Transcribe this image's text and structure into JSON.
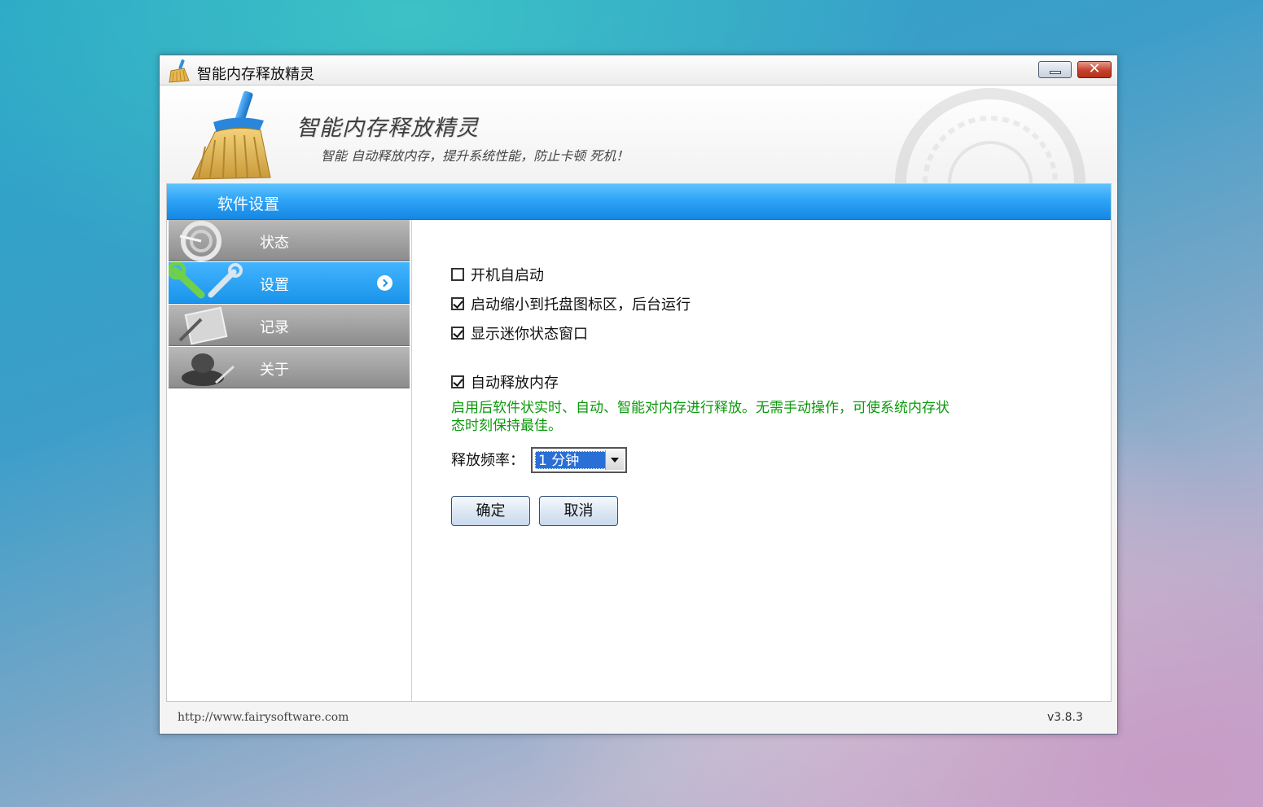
{
  "window": {
    "title": "智能内存释放精灵",
    "controls": {
      "minimize_icon": "minimize-icon",
      "close_icon": "close-icon",
      "close_glyph": "✕"
    }
  },
  "header": {
    "app_title": "智能内存释放精灵",
    "slogan": "智能 自动释放内存，提升系统性能，防止卡顿 死机！"
  },
  "section_title": "软件设置",
  "sidebar": {
    "items": [
      {
        "label": "状态",
        "icon": "gauge-icon",
        "active": false
      },
      {
        "label": "设置",
        "icon": "wrench-icon",
        "active": true
      },
      {
        "label": "记录",
        "icon": "log-icon",
        "active": false
      },
      {
        "label": "关于",
        "icon": "about-icon",
        "active": false
      }
    ]
  },
  "settings": {
    "checkboxes": [
      {
        "label": "开机自启动",
        "checked": false
      },
      {
        "label": "启动缩小到托盘图标区，后台运行",
        "checked": true
      },
      {
        "label": "显示迷你状态窗口",
        "checked": true
      },
      {
        "label": "自动释放内存",
        "checked": true
      }
    ],
    "description": "启用后软件状实时、自动、智能对内存进行释放。无需手动操作，可使系统内存状态时刻保持最佳。",
    "frequency_label": "释放频率：",
    "frequency_value": "1 分钟",
    "ok_button": "确定",
    "cancel_button": "取消"
  },
  "footer": {
    "url": "http://www.fairysoftware.com",
    "version": "v3.8.3"
  },
  "colors": {
    "accent_blue": "#1a94ea",
    "description_green": "#0a9a0a",
    "inactive_nav": "#9e9e9e"
  }
}
